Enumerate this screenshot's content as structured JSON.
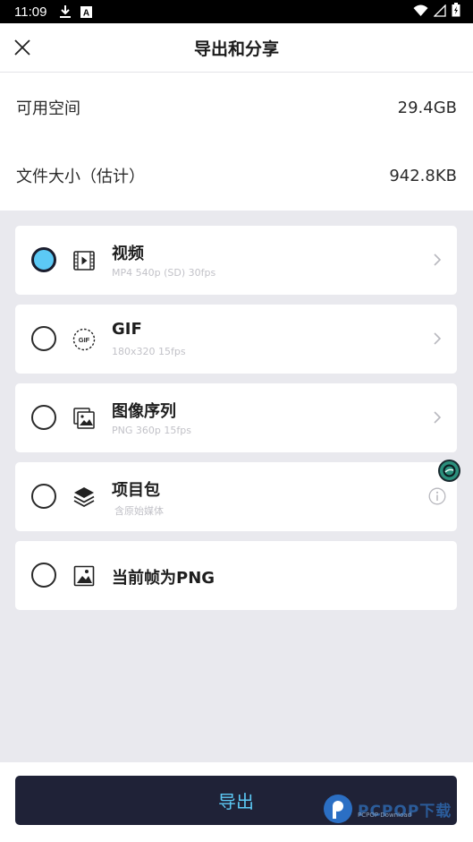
{
  "status_bar": {
    "time": "11:09",
    "icons": [
      "download-icon",
      "a-badge-icon",
      "wifi-icon",
      "signal-icon",
      "battery-icon"
    ]
  },
  "header": {
    "title": "导出和分享",
    "close_icon": "close-icon"
  },
  "info": {
    "available_space_label": "可用空间",
    "available_space_value": "29.4GB",
    "file_size_label": "文件大小（估计）",
    "file_size_value": "942.8KB"
  },
  "options": [
    {
      "title": "视频",
      "subtitle": "MP4 540p (SD) 30fps",
      "icon": "video-icon",
      "selected": true,
      "trailing": "chevron-right-icon"
    },
    {
      "title": "GIF",
      "subtitle": "180x320 15fps",
      "icon": "gif-icon",
      "selected": false,
      "trailing": "chevron-right-icon"
    },
    {
      "title": "图像序列",
      "subtitle": "PNG 360p 15fps",
      "icon": "image-sequence-icon",
      "selected": false,
      "trailing": "chevron-right-icon"
    },
    {
      "title": "项目包",
      "subtitle": "含原始媒体",
      "icon": "layers-icon",
      "selected": false,
      "trailing": "info-icon"
    },
    {
      "title": "当前帧为PNG",
      "subtitle": "",
      "icon": "image-icon",
      "selected": false,
      "trailing": ""
    }
  ],
  "export_button": "导出",
  "watermark": {
    "text": "PCPOP下载",
    "sub": "PCPOP Download"
  },
  "colors": {
    "accent": "#5cc9f5",
    "dark": "#1f2237",
    "background": "#e9e9ee"
  }
}
